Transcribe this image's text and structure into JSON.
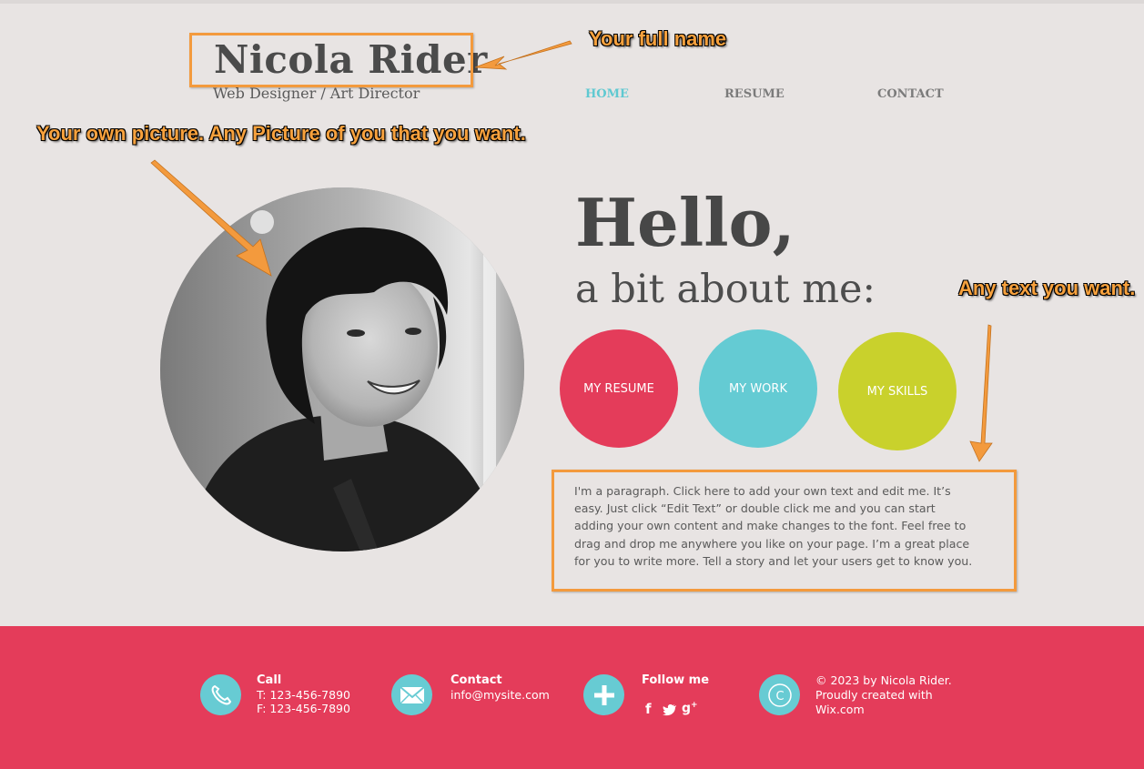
{
  "header": {
    "name": "Nicola Rider",
    "subtitle": "Web Designer / Art Director",
    "nav": [
      {
        "label": "HOME",
        "active": true
      },
      {
        "label": "RESUME",
        "active": false
      },
      {
        "label": "CONTACT",
        "active": false
      }
    ]
  },
  "annotations": {
    "name": "Your full name",
    "picture": "Your own picture. Any Picture of you that you want.",
    "text": "Any text you want.",
    "color": "#f39a3d"
  },
  "hero": {
    "greeting": "Hello,",
    "subheading": "a bit about me:",
    "buttons": [
      {
        "label": "MY RESUME",
        "color": "#e43c5a"
      },
      {
        "label": "MY WORK",
        "color": "#64cbd3"
      },
      {
        "label": "MY SKILLS",
        "color": "#c9d12c"
      }
    ],
    "paragraph": "I'm a paragraph. Click here to add your own text and edit me. It’s easy. Just click “Edit Text” or double click me and you can start adding your own content and make changes to the font. Feel free to drag and drop me anywhere you like on your page. I’m a great place for you to write more. Tell a story and let your users get to know you."
  },
  "footer": {
    "call": {
      "heading": "Call",
      "phone": "T: 123-456-7890",
      "fax": "F: 123-456-7890",
      "icon": "phone-icon"
    },
    "contact": {
      "heading": "Contact",
      "email": "info@mysite.com",
      "icon": "envelope-icon"
    },
    "follow": {
      "heading": "Follow me",
      "icon": "plus-icon",
      "social": [
        "f",
        "twitter",
        "g+"
      ]
    },
    "copyright": {
      "line1": "© 2023 by Nicola Rider.",
      "line2": "Proudly created with",
      "line3": "Wix.com",
      "icon": "copyright-icon"
    },
    "background": "#e43c5a",
    "icon_color": "#67cbd3"
  }
}
